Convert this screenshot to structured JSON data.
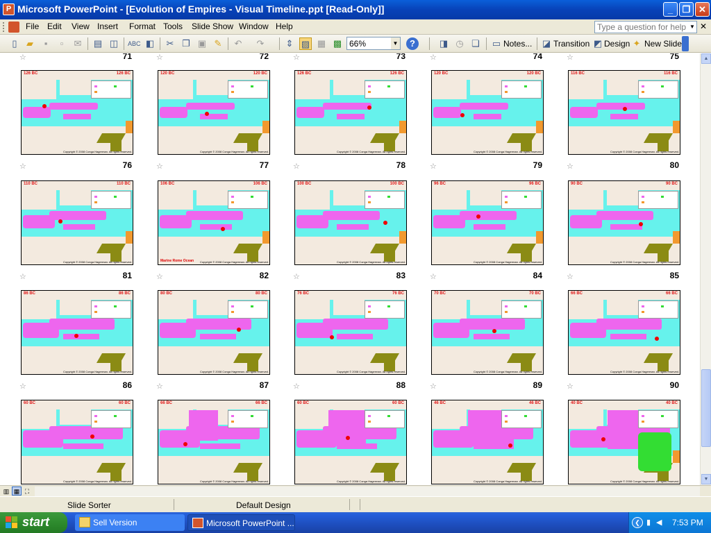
{
  "window": {
    "title": "Microsoft PowerPoint - [Evolution of Empires - Visual Timeline.ppt [Read-Only]]",
    "app_icon_letter": "P",
    "buttons": {
      "minimize": "_",
      "maximize": "❐",
      "close": "✕"
    }
  },
  "menu": {
    "items": [
      "File",
      "Edit",
      "View",
      "Insert",
      "Format",
      "Tools",
      "Slide Show",
      "Window",
      "Help"
    ],
    "help_placeholder": "Type a question for help",
    "close_glyph": "✕"
  },
  "toolbar": {
    "zoom": "66%",
    "notes_label": "Notes...",
    "transition_label": "Transition",
    "design_label": "Design",
    "new_slide_label": "New Slide",
    "icons": [
      "new-icon",
      "open-icon",
      "save-icon",
      "permission-icon",
      "email-icon",
      "print-icon",
      "print-preview-icon",
      "spelling-icon",
      "research-icon",
      "cut-icon",
      "copy-icon",
      "paste-icon",
      "format-painter-icon",
      "undo-icon",
      "redo-icon",
      "expand-icon",
      "color-grayscale-icon",
      "grid-icon",
      "help-icon"
    ]
  },
  "sorter": {
    "header_numbers": [
      "71",
      "72",
      "73",
      "74",
      "75"
    ],
    "rows": [
      {
        "slides": [
          {
            "year": "126 BC"
          },
          {
            "year": "120 BC"
          },
          {
            "year": "126 BC"
          },
          {
            "year": "120 BC"
          },
          {
            "year": "116 BC"
          }
        ],
        "numbers": [
          "76",
          "77",
          "78",
          "79",
          "80"
        ]
      },
      {
        "slides": [
          {
            "year": "110 BC"
          },
          {
            "year": "106 BC"
          },
          {
            "year": "100 BC"
          },
          {
            "year": "96 BC"
          },
          {
            "year": "90 BC"
          }
        ],
        "numbers": [
          "81",
          "82",
          "83",
          "84",
          "85"
        ]
      },
      {
        "slides": [
          {
            "year": "86 BC"
          },
          {
            "year": "80 BC"
          },
          {
            "year": "76 BC"
          },
          {
            "year": "70 BC"
          },
          {
            "year": "66 BC"
          }
        ],
        "numbers": [
          "86",
          "87",
          "88",
          "89",
          "90"
        ]
      },
      {
        "slides": [
          {
            "year": "60 BC"
          },
          {
            "year": "66 BC"
          },
          {
            "year": "60 BC"
          },
          {
            "year": "46 BC"
          },
          {
            "year": "40 BC"
          }
        ],
        "numbers": []
      }
    ],
    "copyright_text": "Copyright © 2008 Conga Hagerman. All rights reserved.",
    "annotation_slide_82": "Marine Rome Ocean"
  },
  "colors": {
    "sea": "#66f2ec",
    "empire": "#ee66ee",
    "land": "#f3eadf",
    "olive": "#8b8b14",
    "orange": "#f2992e",
    "green": "#33dd33",
    "year_red": "#e01818"
  },
  "status": {
    "view": "Slide Sorter",
    "design": "Default Design"
  },
  "taskbar": {
    "start_label": "start",
    "tasks": [
      {
        "label": "Sell Version",
        "icon": "folder-icon"
      },
      {
        "label": "Microsoft PowerPoint ...",
        "icon": "powerpoint-icon"
      }
    ],
    "time": "7:53 PM"
  }
}
